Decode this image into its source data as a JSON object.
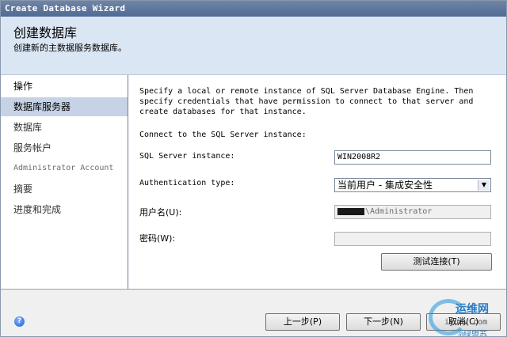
{
  "window": {
    "title": "Create Database Wizard"
  },
  "header": {
    "title": "创建数据库",
    "subtitle": "创建新的主数据服务数据库。"
  },
  "sidebar": {
    "items": [
      {
        "label": "操作"
      },
      {
        "label": "数据库服务器"
      },
      {
        "label": "数据库"
      },
      {
        "label": "服务帐户"
      },
      {
        "label": "Administrator Account"
      },
      {
        "label": "摘要"
      },
      {
        "label": "进度和完成"
      }
    ],
    "active_index": 1
  },
  "main": {
    "description": "Specify a local or remote instance of SQL Server Database Engine. Then specify credentials that have permission to connect to that server and create databases for that instance.",
    "connect_label": "Connect to the SQL Server instance:",
    "instance_label": "SQL Server instance:",
    "instance_value": "WIN2008R2",
    "auth_label": "Authentication type:",
    "auth_value": "当前用户 - 集成安全性",
    "username_label": "用户名(U):",
    "username_value": "\\Administrator",
    "password_label": "密码(W):",
    "password_value": "",
    "test_button": "测试连接(T)"
  },
  "footer": {
    "help_icon": "?",
    "back_button": "上一步(P)",
    "next_button": "下一步(N)",
    "cancel_button": "取消(C)"
  },
  "watermark": {
    "line1": "运维网",
    "line2": "iyunv.com",
    "line3": "@绿盟苏"
  },
  "colors": {
    "header_bg": "#dbe6f4",
    "active_item_bg": "#c6d3e6",
    "titlebar": "#506a93"
  }
}
